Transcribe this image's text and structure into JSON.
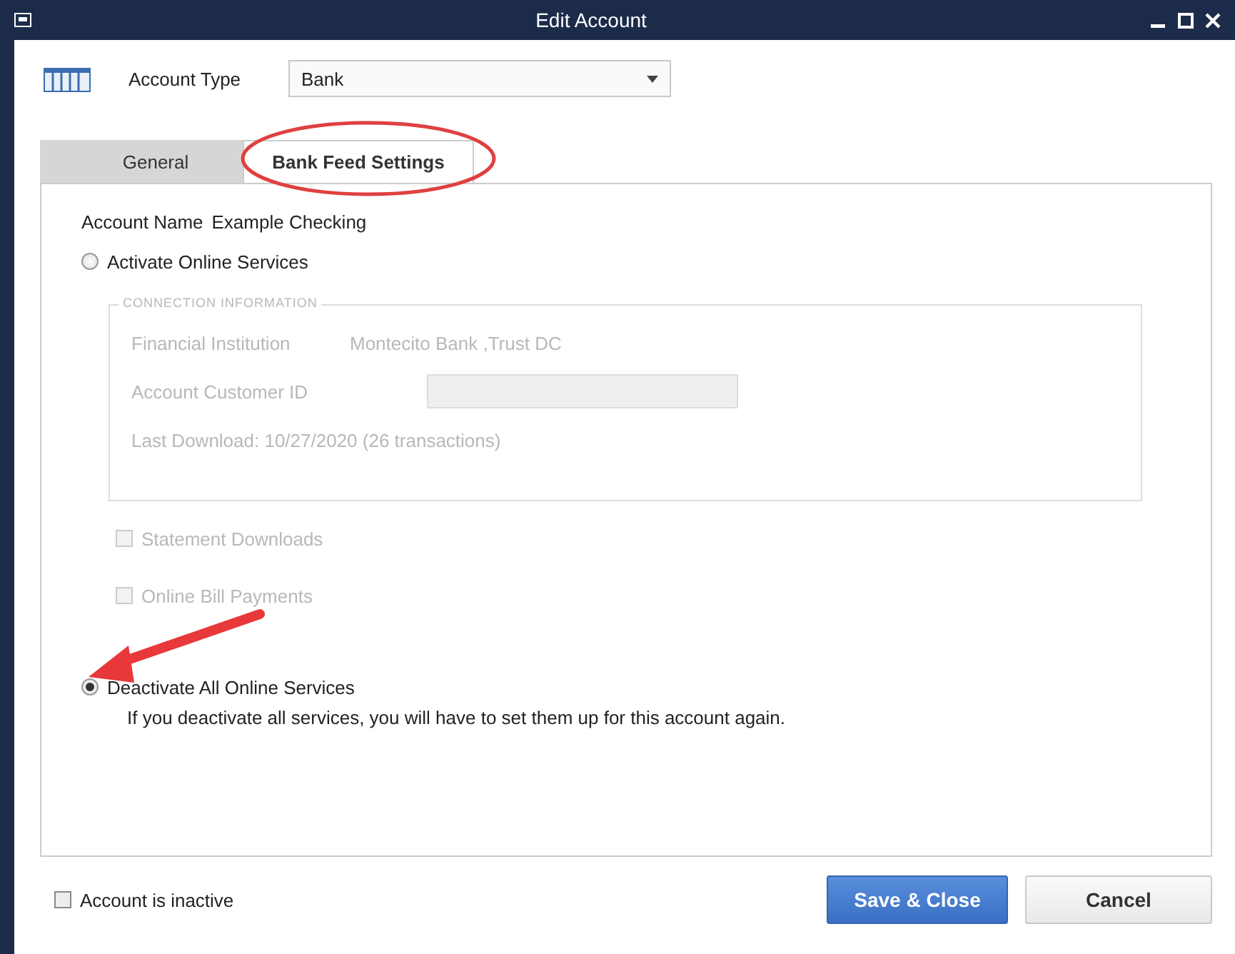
{
  "window": {
    "title": "Edit Account"
  },
  "account_type": {
    "label": "Account Type",
    "value": "Bank"
  },
  "tabs": [
    {
      "label": "General",
      "selected": false
    },
    {
      "label": "Bank Feed Settings",
      "selected": true
    }
  ],
  "account_name": {
    "label": "Account Name",
    "value": "Example Checking"
  },
  "activate_option": {
    "label": "Activate Online Services",
    "selected": false
  },
  "connection_information": {
    "title": "CONNECTION INFORMATION",
    "disabled": true,
    "financial_institution": {
      "label": "Financial Institution",
      "value": "Montecito Bank ,Trust DC"
    },
    "customer_id": {
      "label": "Account Customer ID"
    },
    "last_download": "Last Download: 10/27/2020 (26 transactions)"
  },
  "services": [
    {
      "label": "Statement Downloads",
      "checked": false,
      "disabled": true
    },
    {
      "label": "Online Bill Payments",
      "checked": false,
      "disabled": true
    }
  ],
  "deactivate_option": {
    "label": "Deactivate All Online Services",
    "selected": true,
    "note": "If you deactivate all services, you will have to set them up for this account again."
  },
  "inactive_checkbox": {
    "label": "Account is inactive",
    "checked": false
  },
  "buttons": [
    {
      "label": "Save & Close",
      "kind": "primary"
    },
    {
      "label": "Cancel",
      "kind": "secondary"
    }
  ]
}
